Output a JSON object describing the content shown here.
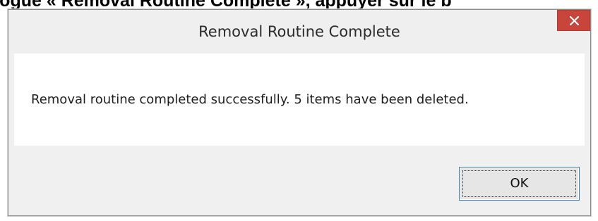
{
  "caption": {
    "text": "de dialogue « Removal Routine Complete », appuyer sur le b"
  },
  "dialog": {
    "title": "Removal Routine Complete",
    "close_icon": "close-icon",
    "message": "Removal routine completed successfully. 5 items have been deleted.",
    "ok_label": "OK"
  },
  "colors": {
    "close_button": "#c7453b",
    "ok_border": "#3c7fb1",
    "dialog_background": "#f0f0f0",
    "message_background": "#ffffff"
  }
}
